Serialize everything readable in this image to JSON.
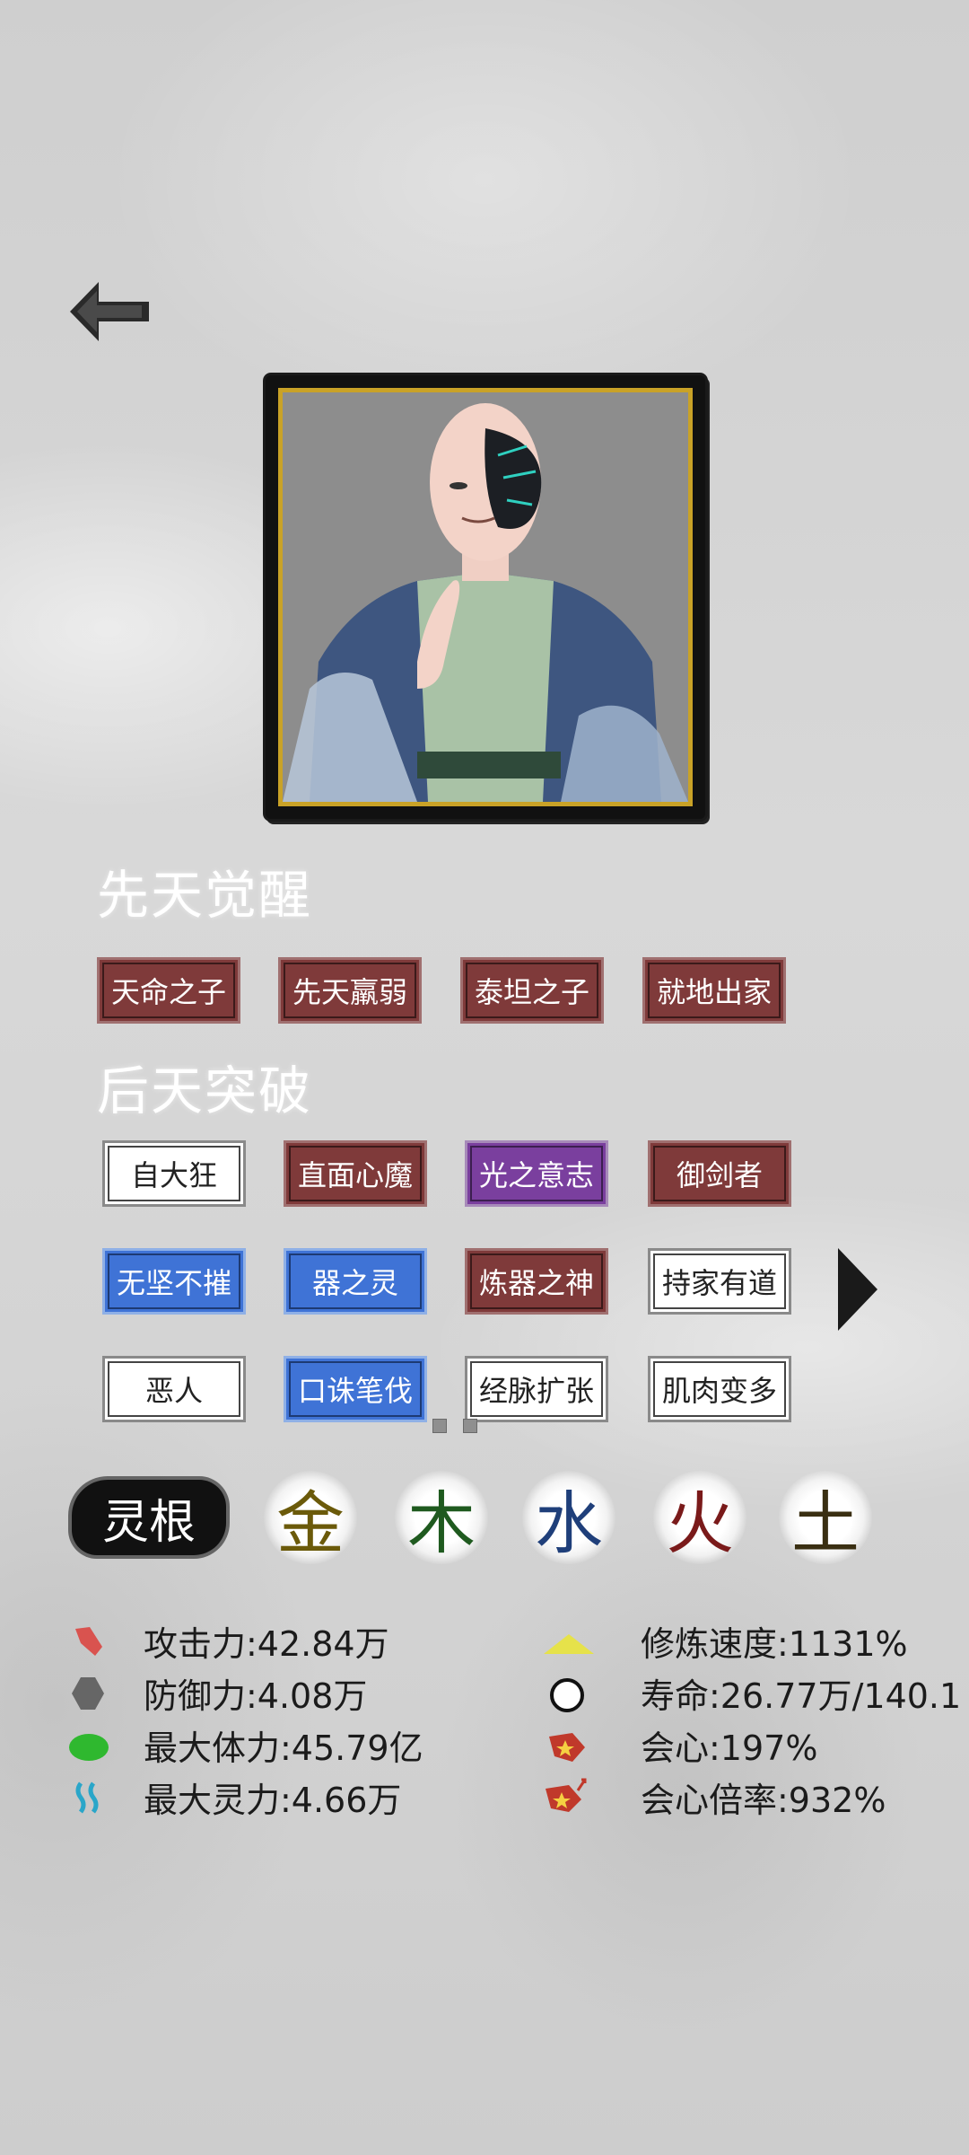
{
  "back": {
    "icon": "back-arrow-icon"
  },
  "portrait": {
    "alt": "character-portrait"
  },
  "innate": {
    "title": "先天觉醒",
    "traits": [
      {
        "label": "天命之子",
        "color": "red"
      },
      {
        "label": "先天羸弱",
        "color": "red"
      },
      {
        "label": "泰坦之子",
        "color": "red"
      },
      {
        "label": "就地出家",
        "color": "red"
      }
    ]
  },
  "acquired": {
    "title": "后天突破",
    "traits": [
      {
        "label": "自大狂",
        "color": "white"
      },
      {
        "label": "直面心魔",
        "color": "red"
      },
      {
        "label": "光之意志",
        "color": "purple"
      },
      {
        "label": "御剑者",
        "color": "red"
      },
      {
        "label": "无坚不摧",
        "color": "blue"
      },
      {
        "label": "器之灵",
        "color": "blue"
      },
      {
        "label": "炼器之神",
        "color": "red"
      },
      {
        "label": "持家有道",
        "color": "white"
      },
      {
        "label": "恶人",
        "color": "white"
      },
      {
        "label": "口诛笔伐",
        "color": "blue"
      },
      {
        "label": "经脉扩张",
        "color": "white"
      },
      {
        "label": "肌肉变多",
        "color": "white"
      }
    ],
    "next_icon": "next-page-arrow-icon"
  },
  "spirit_root": {
    "label": "灵根",
    "elements": [
      {
        "char": "金",
        "color": "#6b5a0a"
      },
      {
        "char": "木",
        "color": "#1f5a1f"
      },
      {
        "char": "水",
        "color": "#1f3f7a"
      },
      {
        "char": "火",
        "color": "#7a1a1a"
      },
      {
        "char": "土",
        "color": "#3a2f12"
      }
    ]
  },
  "stats": {
    "attack": {
      "text": "攻击力:42.84万",
      "icon": "attack-icon",
      "color": "#d9534f"
    },
    "defense": {
      "text": "防御力:4.08万",
      "icon": "defense-icon",
      "color": "#666666"
    },
    "max_hp": {
      "text": "最大体力:45.79亿",
      "icon": "health-icon",
      "color": "#2fb82f"
    },
    "max_mp": {
      "text": "最大灵力:4.66万",
      "icon": "spirit-icon",
      "color": "#2aa6c9"
    },
    "cultivation_speed": {
      "text": "修炼速度:1131%",
      "icon": "cultivation-speed-icon",
      "color": "#e6e24a"
    },
    "lifespan": {
      "text": "寿命:26.77万/140.1",
      "icon": "lifespan-icon"
    },
    "crit": {
      "text": "会心:197%",
      "icon": "crit-icon",
      "color": "#c0392b"
    },
    "crit_multiplier": {
      "text": "会心倍率:932%",
      "icon": "crit-multiplier-icon",
      "color": "#c0392b"
    }
  }
}
